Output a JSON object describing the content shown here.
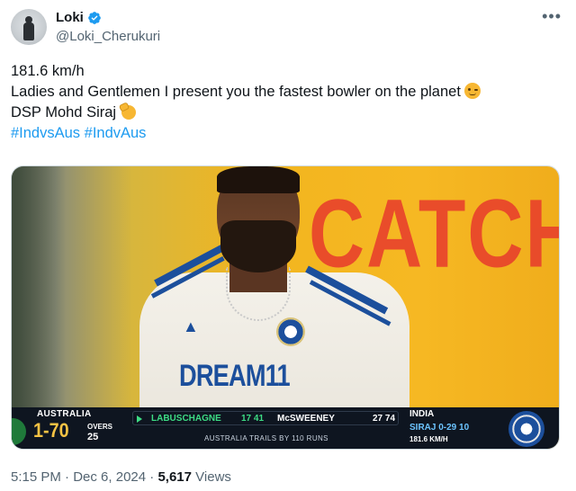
{
  "user": {
    "name": "Loki",
    "handle": "@Loki_Cherukuri"
  },
  "tweet": {
    "line1": "181.6 km/h",
    "line2": "Ladies and Gentlemen I present you the fastest bowler on the planet",
    "line3": "DSP Mohd Siraj",
    "hashtag1": "#IndvsAus",
    "hashtag2": "#IndvAus",
    "emoji1": "winking-face",
    "emoji2": "saluting-face"
  },
  "media": {
    "background_text": "CATCH",
    "jersey_sponsor": "DREAM11",
    "scoreboard": {
      "batting_team": "AUSTRALIA",
      "score": "1-70",
      "overs_label": "OVERS",
      "overs": "25",
      "batter1_name": "LABUSCHAGNE",
      "batter1_score": "17 41",
      "batter2_name": "McSWEENEY",
      "batter2_score": "27 74",
      "trail_text": "AUSTRALIA TRAILS BY 110 RUNS",
      "bowling_team": "INDIA",
      "bowler": "SIRAJ 0-29 10",
      "speed": "181.6 KM/H"
    }
  },
  "meta": {
    "time": "5:15 PM",
    "sep1": " · ",
    "date": "Dec 6, 2024",
    "sep2": " · ",
    "views_count": "5,617",
    "views_label": " Views"
  },
  "colors": {
    "link": "#1d9bf0",
    "verified": "#1d9bf0",
    "secondary_text": "#536471",
    "score_yellow": "#f6c344"
  }
}
